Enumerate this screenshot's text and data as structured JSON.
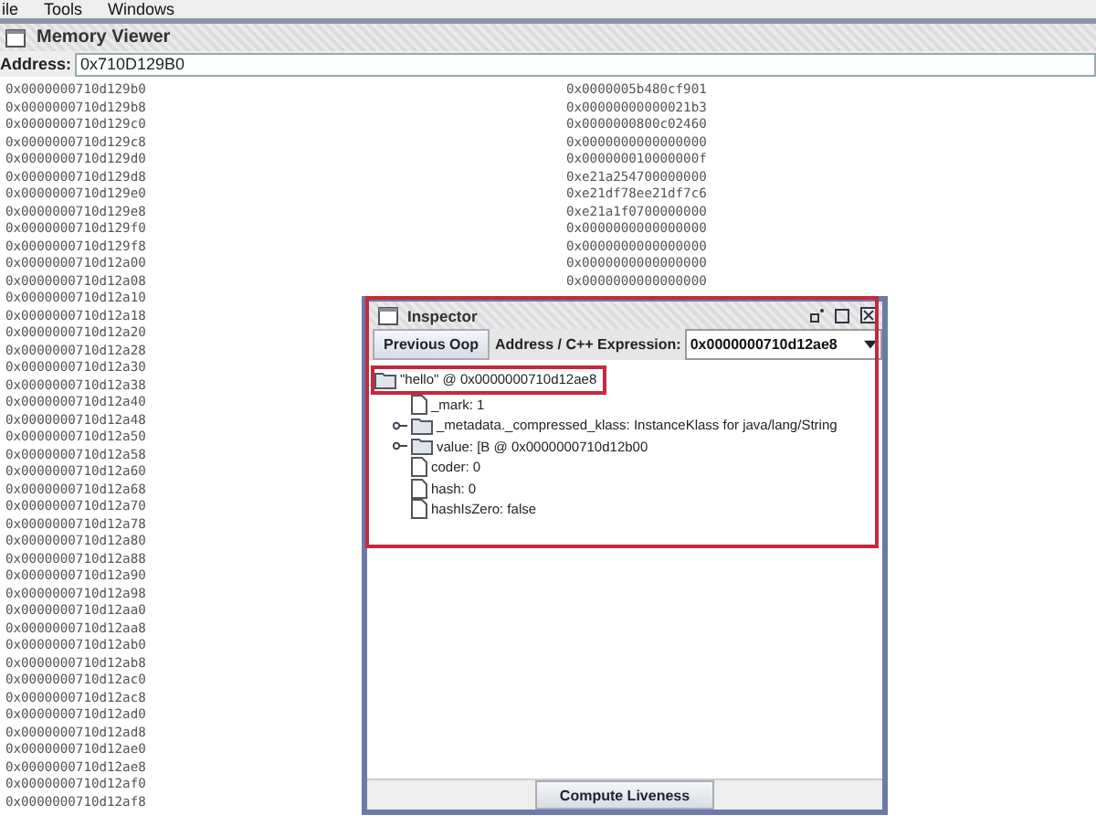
{
  "menu": [
    "ile",
    "Tools",
    "Windows"
  ],
  "memory_viewer": {
    "title": "Memory Viewer",
    "address_label": "Address:",
    "address": "0x710D129B0",
    "rows": [
      {
        "address": "0x0000000710d129b0",
        "value": "0x0000005b480cf901"
      },
      {
        "address": "0x0000000710d129b8",
        "value": "0x00000000000021b3"
      },
      {
        "address": "0x0000000710d129c0",
        "value": "0x0000000800c02460"
      },
      {
        "address": "0x0000000710d129c8",
        "value": "0x0000000000000000"
      },
      {
        "address": "0x0000000710d129d0",
        "value": "0x000000010000000f"
      },
      {
        "address": "0x0000000710d129d8",
        "value": "0xe21a254700000000"
      },
      {
        "address": "0x0000000710d129e0",
        "value": "0xe21df78ee21df7c6"
      },
      {
        "address": "0x0000000710d129e8",
        "value": "0xe21a1f0700000000"
      },
      {
        "address": "0x0000000710d129f0",
        "value": "0x0000000000000000"
      },
      {
        "address": "0x0000000710d129f8",
        "value": "0x0000000000000000"
      },
      {
        "address": "0x0000000710d12a00",
        "value": "0x0000000000000000"
      },
      {
        "address": "0x0000000710d12a08",
        "value": "0x0000000000000000"
      },
      {
        "address": "0x0000000710d12a10"
      },
      {
        "address": "0x0000000710d12a18"
      },
      {
        "address": "0x0000000710d12a20"
      },
      {
        "address": "0x0000000710d12a28"
      },
      {
        "address": "0x0000000710d12a30"
      },
      {
        "address": "0x0000000710d12a38"
      },
      {
        "address": "0x0000000710d12a40"
      },
      {
        "address": "0x0000000710d12a48"
      },
      {
        "address": "0x0000000710d12a50"
      },
      {
        "address": "0x0000000710d12a58"
      },
      {
        "address": "0x0000000710d12a60"
      },
      {
        "address": "0x0000000710d12a68"
      },
      {
        "address": "0x0000000710d12a70"
      },
      {
        "address": "0x0000000710d12a78"
      },
      {
        "address": "0x0000000710d12a80"
      },
      {
        "address": "0x0000000710d12a88"
      },
      {
        "address": "0x0000000710d12a90"
      },
      {
        "address": "0x0000000710d12a98"
      },
      {
        "address": "0x0000000710d12aa0"
      },
      {
        "address": "0x0000000710d12aa8"
      },
      {
        "address": "0x0000000710d12ab0"
      },
      {
        "address": "0x0000000710d12ab8"
      },
      {
        "address": "0x0000000710d12ac0"
      },
      {
        "address": "0x0000000710d12ac8"
      },
      {
        "address": "0x0000000710d12ad0"
      },
      {
        "address": "0x0000000710d12ad8"
      },
      {
        "address": "0x0000000710d12ae0"
      },
      {
        "address": "0x0000000710d12ae8"
      },
      {
        "address": "0x0000000710d12af0"
      },
      {
        "address": "0x0000000710d12af8"
      }
    ]
  },
  "inspector": {
    "title": "Inspector",
    "previous_button": "Previous Oop",
    "expression_label": "Address / C++ Expression:",
    "expression": "0x0000000710d12ae8",
    "tree": [
      {
        "label": "\"hello\" @ 0x0000000710d12ae8",
        "kind": "object",
        "expanded": true,
        "children": [
          {
            "label": "_mark: 1",
            "kind": "leaf"
          },
          {
            "label": "_metadata._compressed_klass: InstanceKlass for java/lang/String",
            "kind": "object",
            "expanded": false
          },
          {
            "label": "value: [B @ 0x0000000710d12b00",
            "kind": "object",
            "expanded": false
          },
          {
            "label": "coder: 0",
            "kind": "leaf"
          },
          {
            "label": "hash: 0",
            "kind": "leaf"
          },
          {
            "label": "hashIsZero: false",
            "kind": "leaf"
          }
        ]
      }
    ],
    "compute_button": "Compute Liveness"
  }
}
